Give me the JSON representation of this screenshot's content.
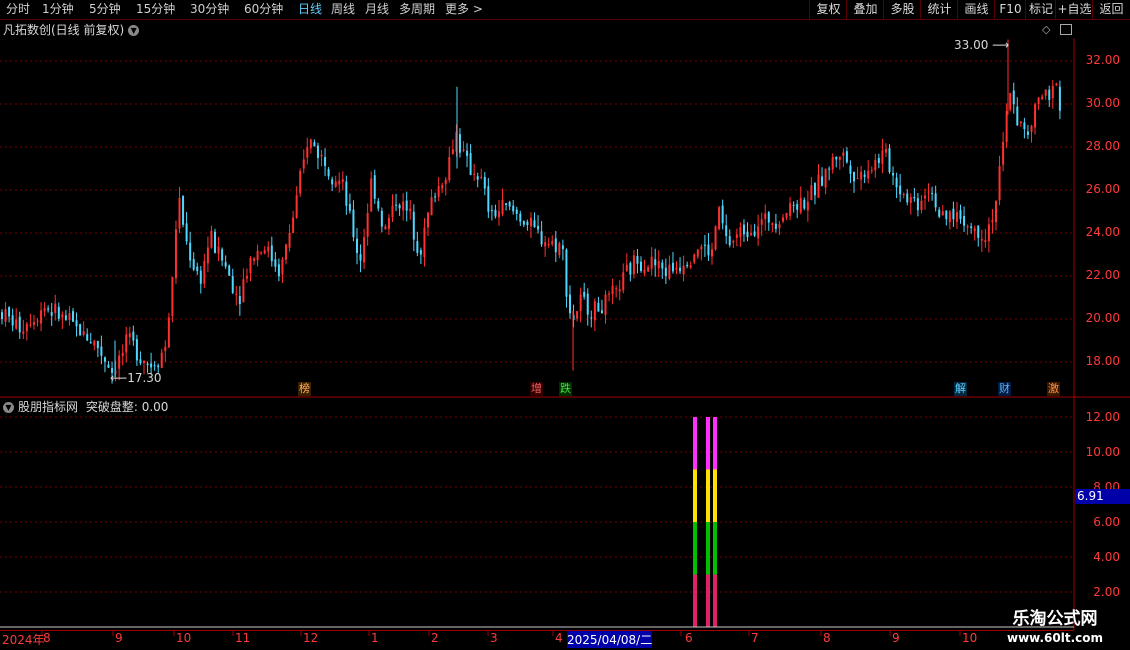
{
  "toolbar": {
    "periods": [
      "分时",
      "1分钟",
      "5分钟",
      "15分钟",
      "30分钟",
      "60分钟",
      "日线",
      "周线",
      "月线",
      "多周期",
      "更多 >"
    ],
    "active_period": "日线",
    "actions": [
      "复权",
      "叠加",
      "多股",
      "统计",
      "画线",
      "F10",
      "标记",
      "+自选",
      "返回"
    ]
  },
  "main_chart": {
    "title": "凡拓数创(日线 前复权)",
    "y_ticks": [
      "32.00",
      "30.00",
      "28.00",
      "26.00",
      "24.00",
      "22.00",
      "20.00",
      "18.00"
    ],
    "high_label": "33.00",
    "low_label": "17.30",
    "markers": [
      {
        "text": "榜",
        "color": "#ffb060",
        "bg": "#3a2000"
      },
      {
        "text": "增",
        "color": "#ff6060",
        "bg": "#300000"
      },
      {
        "text": "跌",
        "color": "#40e040",
        "bg": "#003000"
      },
      {
        "text": "解",
        "color": "#60d0ff",
        "bg": "#002840"
      },
      {
        "text": "财",
        "color": "#60b0ff",
        "bg": "#001a40"
      },
      {
        "text": "激",
        "color": "#ff9040",
        "bg": "#3a1800"
      }
    ]
  },
  "indicator": {
    "name": "股朋指标网",
    "label": "突破盘整: 0.00",
    "y_ticks": [
      "12.00",
      "10.00",
      "8.00",
      "6.00",
      "4.00",
      "2.00"
    ],
    "current_value": "6.91"
  },
  "chart_data": {
    "type": "candlestick",
    "price_range": [
      16.8,
      33.2
    ],
    "indicator_range": [
      0,
      12.6
    ],
    "indicator_bars": [
      {
        "date": "2025-05-20",
        "value": 12,
        "layers": [
          {
            "color": "#e0206a",
            "to": 3
          },
          {
            "color": "#00c000",
            "to": 6
          },
          {
            "color": "#ffe000",
            "to": 9
          },
          {
            "color": "#ff30ff",
            "to": 12
          }
        ]
      },
      {
        "date": "2025-05-23",
        "value": 12,
        "layers": [
          {
            "color": "#e0206a",
            "to": 3
          },
          {
            "color": "#00c000",
            "to": 6
          },
          {
            "color": "#ffe000",
            "to": 9
          },
          {
            "color": "#ff30ff",
            "to": 12
          }
        ]
      },
      {
        "date": "2025-05-26",
        "value": 12,
        "layers": [
          {
            "color": "#e0206a",
            "to": 3
          },
          {
            "color": "#00c000",
            "to": 6
          },
          {
            "color": "#ffe000",
            "to": 9
          },
          {
            "color": "#ff30ff",
            "to": 12
          }
        ]
      }
    ],
    "x_axis": [
      "2024年",
      "8",
      "9",
      "10",
      "11",
      "12",
      "1",
      "2",
      "3",
      "4",
      "2025/04/08/二",
      "6",
      "7",
      "8",
      "9",
      "10"
    ],
    "high": 33.0,
    "low": 17.3
  },
  "watermark": {
    "line1": "乐淘公式网",
    "line2": "www.60lt.com"
  }
}
